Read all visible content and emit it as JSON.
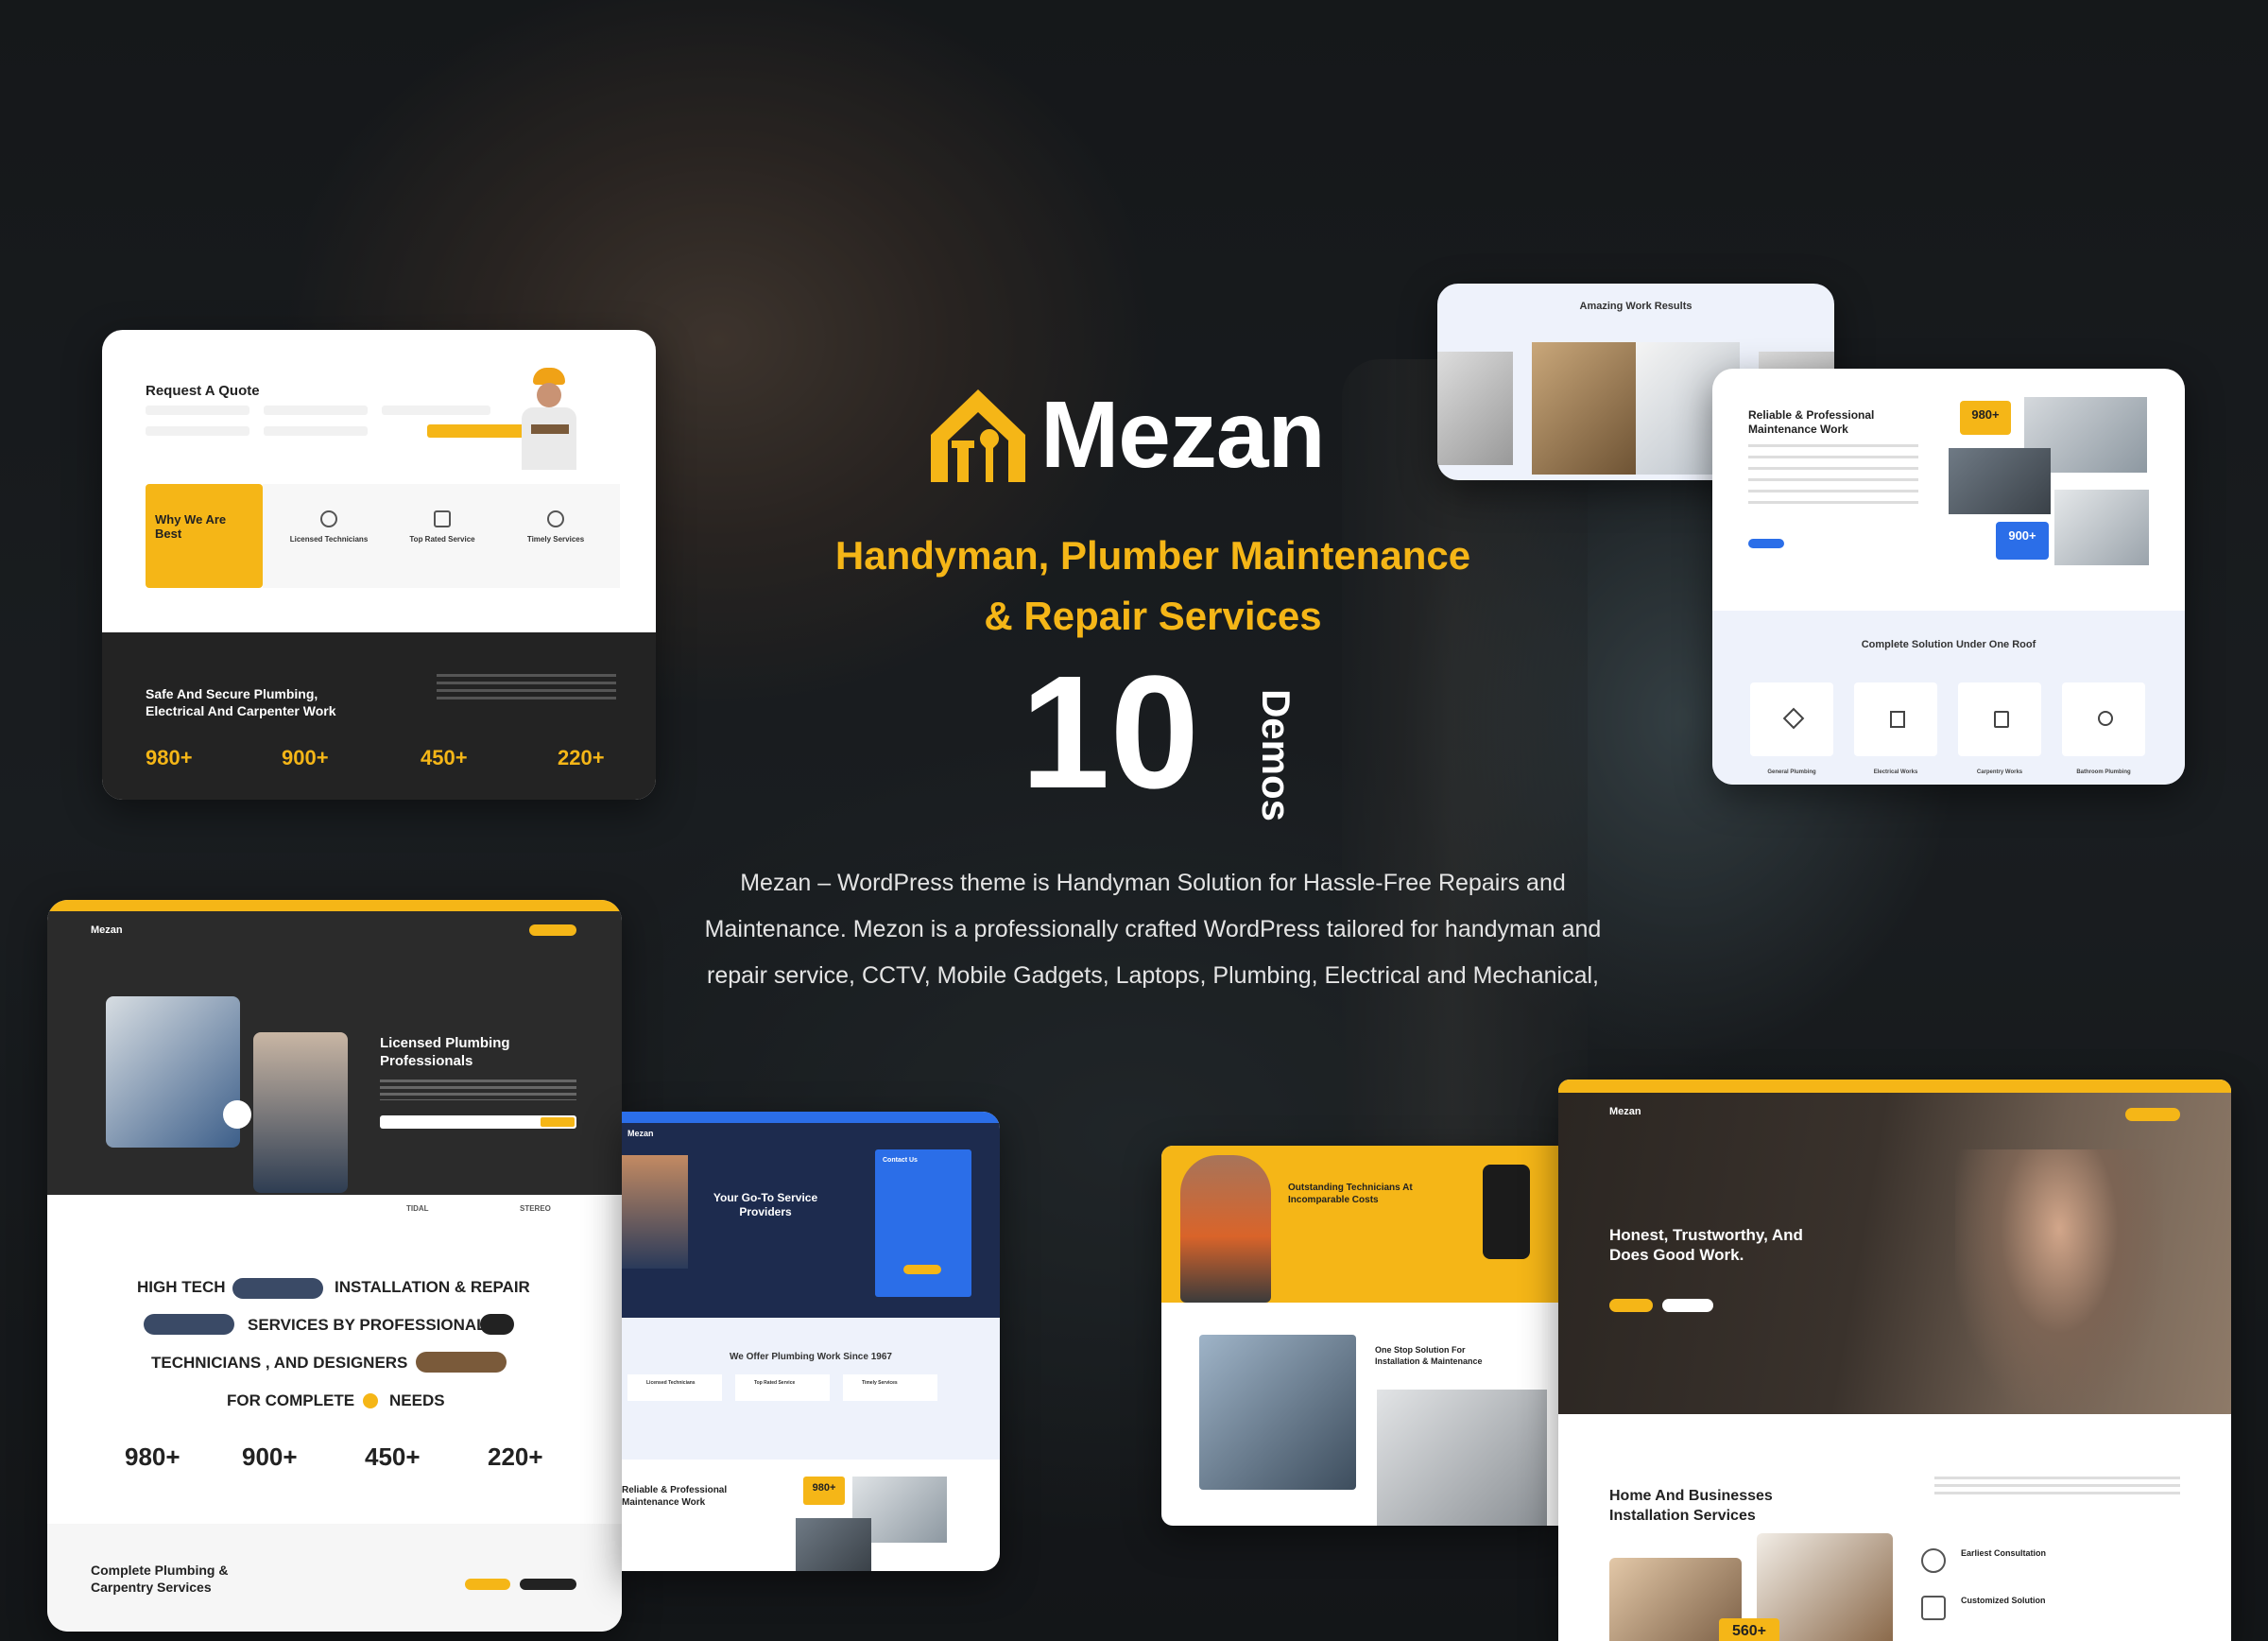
{
  "brand": {
    "name": "Mezan",
    "accent": "#f5b617"
  },
  "hero": {
    "tagline_line1": "Handyman, Plumber Maintenance",
    "tagline_line2": "& Repair Services",
    "demos_count": "10",
    "demos_label": "Demos",
    "description_line1": "Mezan – WordPress theme is Handyman Solution for Hassle-Free Repairs and",
    "description_line2": "Maintenance. Mezon is a professionally crafted WordPress tailored for handyman and",
    "description_line3": "repair service, CCTV, Mobile Gadgets, Laptops, Plumbing, Electrical and Mechanical,"
  },
  "card_quote": {
    "title": "Request A Quote",
    "why_title": "Why We Are Best",
    "features": [
      "Licensed Technicians",
      "Top Rated Service",
      "Timely Services"
    ],
    "dark_title_line1": "Safe And Secure Plumbing,",
    "dark_title_line2": "Electrical And Carpenter  Work",
    "stats": [
      "980+",
      "900+",
      "450+",
      "220+"
    ]
  },
  "card_results": {
    "title": "Amazing Work Results"
  },
  "card_maintenance": {
    "title_line1": "Reliable & Professional",
    "title_line2": "Maintenance Work",
    "badge1": "980+",
    "badge2": "900+",
    "section_title": "Complete Solution Under One Roof",
    "services": [
      "General Plumbing",
      "Electrical Works",
      "Carpentry Works",
      "Bathroom Plumbing"
    ]
  },
  "card_plumbing": {
    "logo": "Mezan",
    "hero_title_line1": "Licensed Plumbing",
    "hero_title_line2": "Professionals",
    "marquee": [
      "HIGH TECH",
      "INSTALLATION & REPAIR",
      "SERVICES BY PROFESSIONAL",
      "TECHNICIANS ,  AND DESIGNERS",
      "FOR COMPLETE",
      "NEEDS"
    ],
    "partners": [
      "TIDAL",
      "STEREO"
    ],
    "stats": [
      "980+",
      "900+",
      "450+",
      "220+"
    ],
    "bottom_title_line1": "Complete Plumbing &",
    "bottom_title_line2": "Carpentry Services"
  },
  "card_goto": {
    "logo": "Mezan",
    "hero_title_line1": "Your Go-To Service",
    "hero_title_line2": "Providers",
    "contact_title": "Contact Us",
    "section_title": "We Offer Plumbing Work Since 1967",
    "features": [
      "Licensed Technicians",
      "Top Rated Service",
      "Timely Services"
    ],
    "bottom_title_line1": "Reliable & Professional",
    "bottom_title_line2": "Maintenance Work",
    "badge": "980+"
  },
  "card_technicians": {
    "title_line1": "Outstanding Technicians At",
    "title_line2": "Incomparable Costs",
    "section_title_line1": "One Stop Solution For",
    "section_title_line2": "Installation & Maintenance"
  },
  "card_honest": {
    "logo": "Mezan",
    "hero_title_line1": "Honest, Trustworthy, And",
    "hero_title_line2": "Does Good Work.",
    "section_title_line1": "Home And Businesses",
    "section_title_line2": "Installation Services",
    "items": [
      "Earliest Consultation",
      "Customized Solution"
    ],
    "badge": "560+"
  }
}
